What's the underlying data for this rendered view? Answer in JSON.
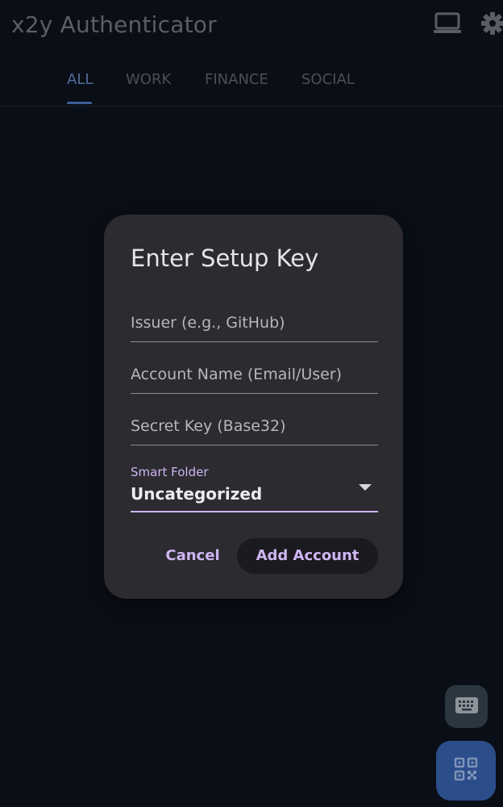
{
  "app": {
    "title": "x2y Authenticator"
  },
  "header": {
    "actions": [
      {
        "icon": "laptop-icon"
      },
      {
        "icon": "gear-icon"
      }
    ]
  },
  "tabs": [
    {
      "label": "ALL",
      "active": true
    },
    {
      "label": "WORK",
      "active": false
    },
    {
      "label": "FINANCE",
      "active": false
    },
    {
      "label": "SOCIAL",
      "active": false
    }
  ],
  "dialog": {
    "title": "Enter Setup Key",
    "fields": {
      "issuer": {
        "placeholder": "Issuer (e.g., GitHub)",
        "value": ""
      },
      "account": {
        "placeholder": "Account Name (Email/User)",
        "value": ""
      },
      "secret": {
        "placeholder": "Secret Key (Base32)",
        "value": ""
      }
    },
    "folder": {
      "label": "Smart Folder",
      "value": "Uncategorized"
    },
    "cancel_label": "Cancel",
    "submit_label": "Add Account"
  },
  "fabs": [
    {
      "icon": "keyboard-icon"
    },
    {
      "icon": "qr-scan-icon"
    }
  ],
  "colors": {
    "background": "#0a0e16",
    "dialog": "#2c2b30",
    "accent": "#cdb6f2",
    "fab_primary": "#2b4d8a",
    "fab_secondary": "#2c363f",
    "tab_active": "#4f6d9a"
  }
}
